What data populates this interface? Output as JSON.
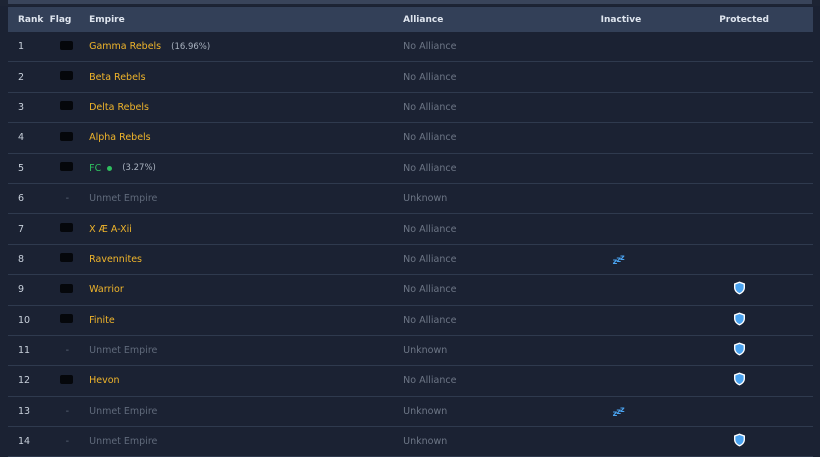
{
  "columns": {
    "rank": "Rank",
    "flag": "Flag",
    "empire": "Empire",
    "alliance": "Alliance",
    "inactive": "Inactive",
    "protected": "Protected"
  },
  "colors": {
    "empire_gold": "#f0b52b",
    "empire_green": "#2fbf5f",
    "unmet_gray": "#606a7b",
    "inactive_icon": "#4aa3f0",
    "shield_icon": "#4aa3f0"
  },
  "rows": [
    {
      "rank": "1",
      "flag": "black",
      "empire": "Gamma Rebels",
      "share": "(16.96%)",
      "alliance": "No Alliance",
      "inactive": false,
      "protected": false
    },
    {
      "rank": "2",
      "flag": "black",
      "empire": "Beta Rebels",
      "share": "",
      "alliance": "No Alliance",
      "inactive": false,
      "protected": false
    },
    {
      "rank": "3",
      "flag": "black",
      "empire": "Delta Rebels",
      "share": "",
      "alliance": "No Alliance",
      "inactive": false,
      "protected": false
    },
    {
      "rank": "4",
      "flag": "black",
      "empire": "Alpha Rebels",
      "share": "",
      "alliance": "No Alliance",
      "inactive": false,
      "protected": false
    },
    {
      "rank": "5",
      "flag": "black",
      "empire": "FC",
      "share": "(3.27%)",
      "alliance": "No Alliance",
      "inactive": false,
      "protected": false,
      "self": true
    },
    {
      "rank": "6",
      "flag": "-",
      "empire": "Unmet Empire",
      "share": "",
      "alliance": "Unknown",
      "inactive": false,
      "protected": false,
      "unmet": true
    },
    {
      "rank": "7",
      "flag": "black",
      "empire": "X Æ A-Xii",
      "share": "",
      "alliance": "No Alliance",
      "inactive": false,
      "protected": false
    },
    {
      "rank": "8",
      "flag": "black",
      "empire": "Ravennites",
      "share": "",
      "alliance": "No Alliance",
      "inactive": true,
      "protected": false
    },
    {
      "rank": "9",
      "flag": "black",
      "empire": "Warrior",
      "share": "",
      "alliance": "No Alliance",
      "inactive": false,
      "protected": true
    },
    {
      "rank": "10",
      "flag": "black",
      "empire": "Finite",
      "share": "",
      "alliance": "No Alliance",
      "inactive": false,
      "protected": true
    },
    {
      "rank": "11",
      "flag": "-",
      "empire": "Unmet Empire",
      "share": "",
      "alliance": "Unknown",
      "inactive": false,
      "protected": true,
      "unmet": true
    },
    {
      "rank": "12",
      "flag": "black",
      "empire": "Hevon",
      "share": "",
      "alliance": "No Alliance",
      "inactive": false,
      "protected": true
    },
    {
      "rank": "13",
      "flag": "-",
      "empire": "Unmet Empire",
      "share": "",
      "alliance": "Unknown",
      "inactive": true,
      "protected": false,
      "unmet": true
    },
    {
      "rank": "14",
      "flag": "-",
      "empire": "Unmet Empire",
      "share": "",
      "alliance": "Unknown",
      "inactive": false,
      "protected": true,
      "unmet": true
    }
  ]
}
